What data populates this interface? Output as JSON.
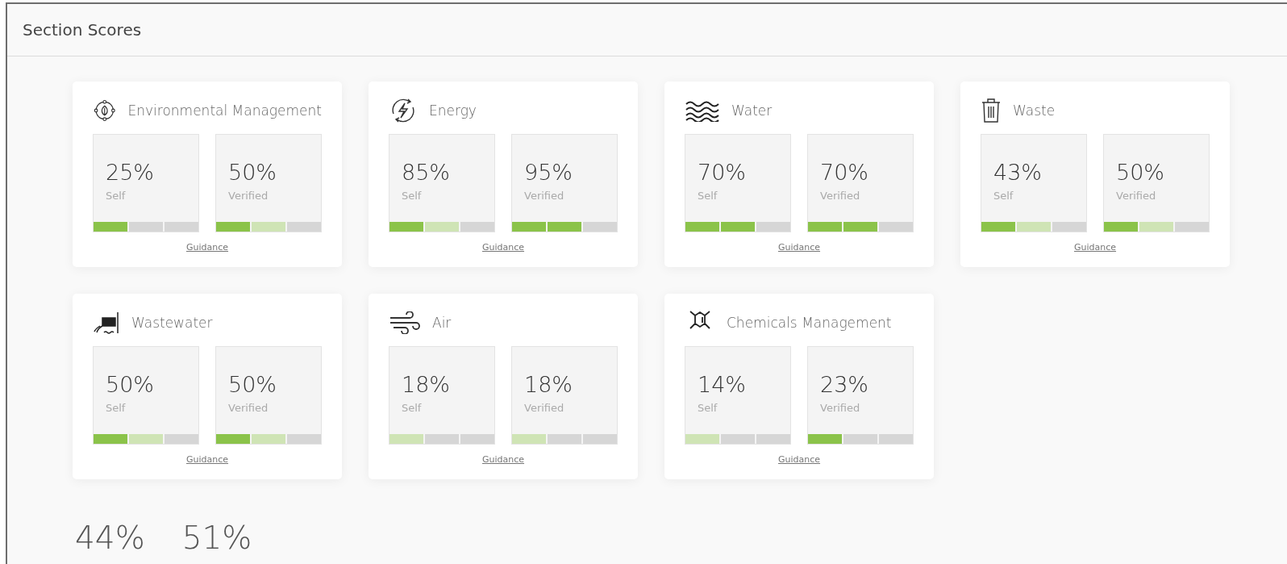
{
  "title": "Section Scores",
  "sections": [
    {
      "kind": "environment",
      "name": "Environmental Management",
      "scores": [
        {
          "value": "25%",
          "label": "Self",
          "bar": [
            {
              "kind": "full"
            },
            {
              "kind": "empty"
            },
            {
              "kind": "empty"
            }
          ]
        },
        {
          "value": "50%",
          "label": "Verified",
          "bar": [
            {
              "kind": "full"
            },
            {
              "kind": "light"
            },
            {
              "kind": "empty"
            }
          ]
        }
      ],
      "link": "Guidance"
    },
    {
      "kind": "energy",
      "name": "Energy",
      "scores": [
        {
          "value": "85%",
          "label": "Self",
          "bar": [
            {
              "kind": "full"
            },
            {
              "kind": "light"
            },
            {
              "kind": "empty"
            }
          ]
        },
        {
          "value": "95%",
          "label": "Verified",
          "bar": [
            {
              "kind": "full"
            },
            {
              "kind": "full"
            },
            {
              "kind": "empty"
            }
          ]
        }
      ],
      "link": "Guidance"
    },
    {
      "kind": "water",
      "name": "Water",
      "scores": [
        {
          "value": "70%",
          "label": "Self",
          "bar": [
            {
              "kind": "full"
            },
            {
              "kind": "full"
            },
            {
              "kind": "empty"
            }
          ]
        },
        {
          "value": "70%",
          "label": "Verified",
          "bar": [
            {
              "kind": "full"
            },
            {
              "kind": "full"
            },
            {
              "kind": "empty"
            }
          ]
        }
      ],
      "link": "Guidance"
    },
    {
      "kind": "waste",
      "name": "Waste",
      "scores": [
        {
          "value": "43%",
          "label": "Self",
          "bar": [
            {
              "kind": "full"
            },
            {
              "kind": "light"
            },
            {
              "kind": "empty"
            }
          ]
        },
        {
          "value": "50%",
          "label": "Verified",
          "bar": [
            {
              "kind": "full"
            },
            {
              "kind": "light"
            },
            {
              "kind": "empty"
            }
          ]
        }
      ],
      "link": "Guidance"
    },
    {
      "kind": "wastewater",
      "name": "Wastewater",
      "scores": [
        {
          "value": "50%",
          "label": "Self",
          "bar": [
            {
              "kind": "full"
            },
            {
              "kind": "light"
            },
            {
              "kind": "empty"
            }
          ]
        },
        {
          "value": "50%",
          "label": "Verified",
          "bar": [
            {
              "kind": "full"
            },
            {
              "kind": "light"
            },
            {
              "kind": "empty"
            }
          ]
        }
      ],
      "link": "Guidance"
    },
    {
      "kind": "air",
      "name": "Air",
      "scores": [
        {
          "value": "18%",
          "label": "Self",
          "bar": [
            {
              "kind": "light"
            },
            {
              "kind": "empty"
            },
            {
              "kind": "empty"
            }
          ]
        },
        {
          "value": "18%",
          "label": "Verified",
          "bar": [
            {
              "kind": "light"
            },
            {
              "kind": "empty"
            },
            {
              "kind": "empty"
            }
          ]
        }
      ],
      "link": "Guidance"
    },
    {
      "kind": "chemicals",
      "name": "Chemicals Management",
      "scores": [
        {
          "value": "14%",
          "label": "Self",
          "bar": [
            {
              "kind": "light"
            },
            {
              "kind": "empty"
            },
            {
              "kind": "empty"
            }
          ]
        },
        {
          "value": "23%",
          "label": "Verified",
          "bar": [
            {
              "kind": "full"
            },
            {
              "kind": "empty"
            },
            {
              "kind": "empty"
            }
          ]
        }
      ],
      "link": "Guidance"
    }
  ],
  "totals": [
    "44%",
    "51%"
  ]
}
